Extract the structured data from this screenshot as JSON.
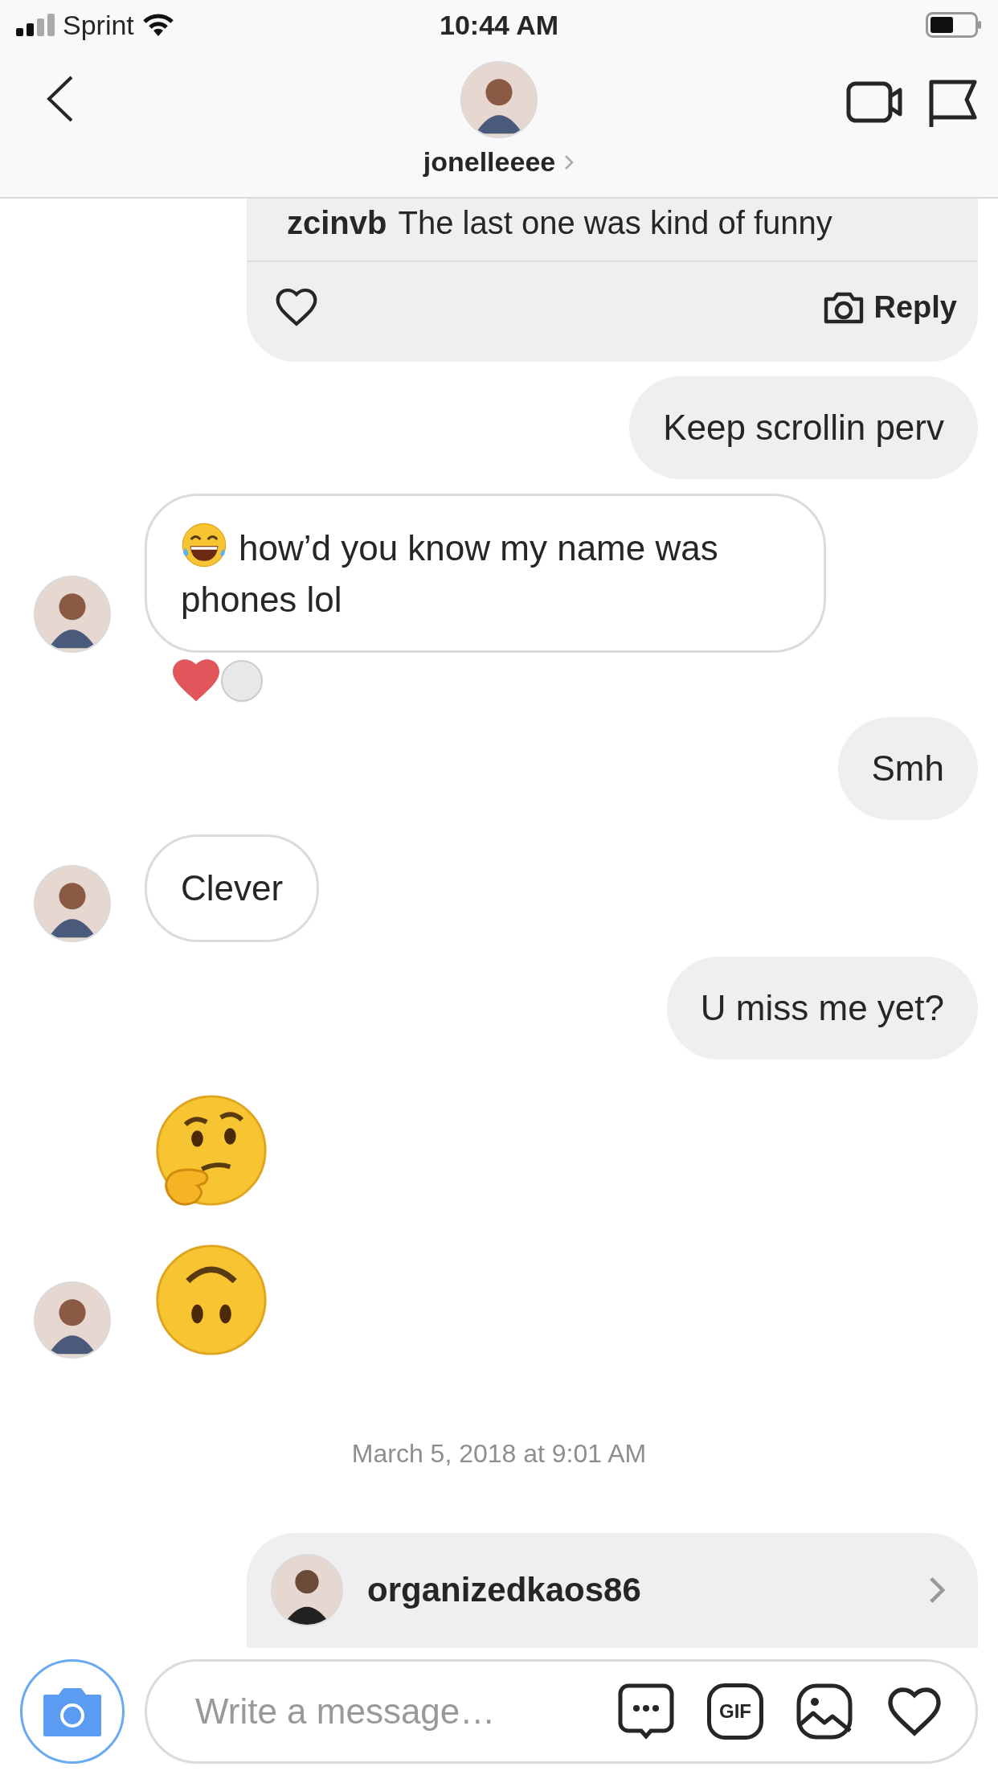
{
  "status_bar": {
    "carrier": "Sprint",
    "time": "10:44 AM"
  },
  "header": {
    "username": "jonelleeee"
  },
  "messages": [
    {
      "kind": "shared_post",
      "author": "zcinvb",
      "text": "The last one was kind of funny",
      "liked": false,
      "reply_label": "Reply"
    },
    {
      "kind": "text",
      "outgoing": true,
      "text": "Keep scrollin perv"
    },
    {
      "kind": "text",
      "outgoing": false,
      "leading_emoji": {
        "kind": "laughing"
      },
      "text": "how’d you know my name was phones lol",
      "show_avatar": true,
      "reactions": [
        {
          "kind": "heart"
        },
        {
          "kind": "avatar"
        }
      ]
    },
    {
      "kind": "text",
      "outgoing": true,
      "text": "Smh"
    },
    {
      "kind": "text",
      "outgoing": false,
      "text": "Clever",
      "show_avatar": true
    },
    {
      "kind": "text",
      "outgoing": true,
      "text": "U miss me yet?"
    },
    {
      "kind": "big_emoji",
      "outgoing": false,
      "emoji": {
        "kind": "thinking"
      },
      "show_avatar": false
    },
    {
      "kind": "big_emoji",
      "outgoing": false,
      "emoji": {
        "kind": "upside_down"
      },
      "show_avatar": true
    },
    {
      "kind": "timestamp",
      "text": "March 5, 2018 at 9:01 AM"
    },
    {
      "kind": "shared_profile",
      "username": "organizedkaos86"
    }
  ],
  "composer": {
    "placeholder": "Write a message…",
    "gif_label": "GIF"
  }
}
